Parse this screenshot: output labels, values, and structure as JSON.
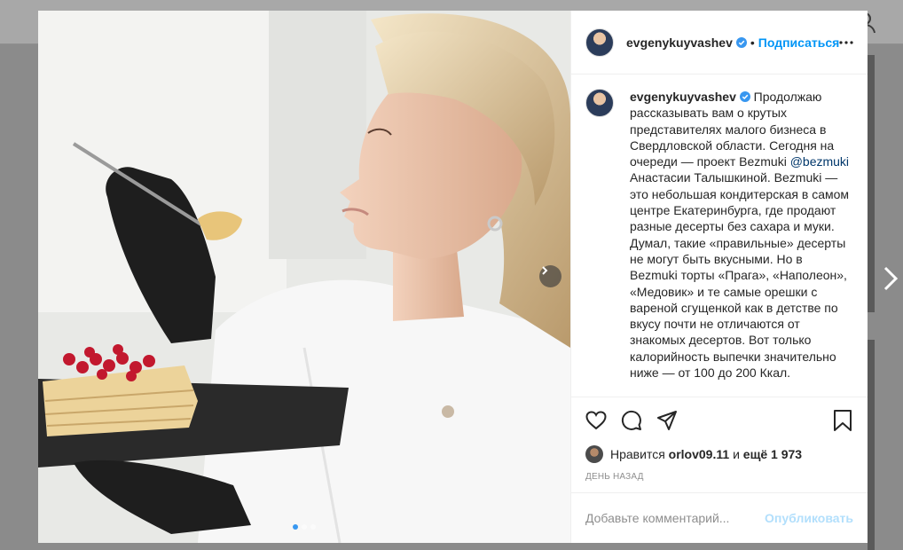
{
  "post": {
    "username": "evgenykuyvashev",
    "separator": "•",
    "follow_label": "Подписаться",
    "verified_icon": "verified-badge-icon",
    "caption": {
      "username": "evgenykuyvashev",
      "part1": "Продолжаю рассказывать вам о крутых представителях малого бизнеса в Свердловской области. Сегодня на очереди — проект Bezmuki",
      "mention": "@bezmuki",
      "part2": "Анастасии Талышкиной. Bezmuki — это небольшая кондитерская в самом центре Екатеринбурга, где продают разные десерты без сахара и муки. Думал, такие «правильные» десерты не могут быть вкусными. Но в Bezmuki торты «Прага», «Наполеон», «Медовик» и те самые орешки с вареной сгущенкой как в детстве по вкусу почти не отличаются от знакомых десертов. Вот только калорийность выпечки значительно ниже — от 100 до 200 Ккал."
    },
    "likes": {
      "prefix": "Нравится",
      "user": "orlov09.11",
      "connector": "и",
      "count": "ещё 1 973"
    },
    "timestamp": "ДЕНЬ НАЗАД",
    "comment": {
      "placeholder": "Добавьте комментарий...",
      "publish_label": "Опубликовать"
    },
    "carousel": {
      "total": 3,
      "active_index": 0
    }
  },
  "colors": {
    "link_blue": "#0095f6",
    "publish_disabled": "#b2dffc",
    "carousel_active_dot": "#3897f0"
  }
}
